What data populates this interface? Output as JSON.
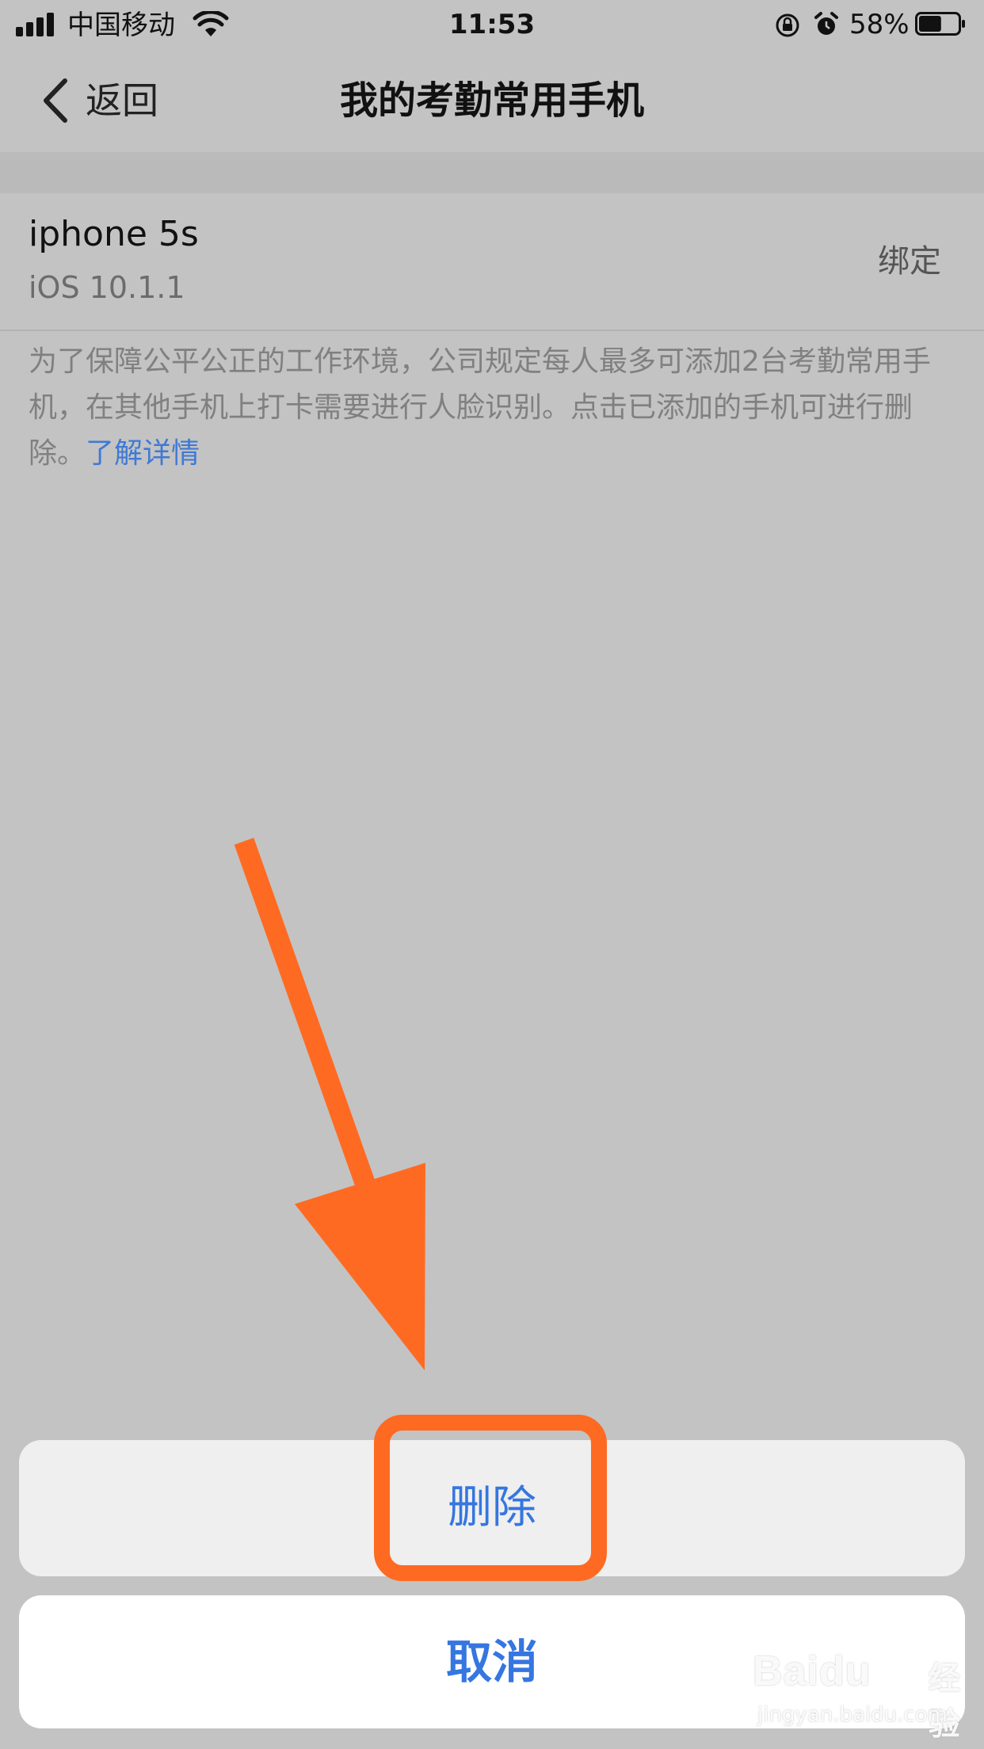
{
  "status_bar": {
    "carrier": "中国移动",
    "time": "11:53",
    "battery_percent": "58%",
    "battery_level": 0.58,
    "icons": [
      "signal-icon",
      "wifi-icon",
      "orientation-lock-icon",
      "alarm-icon",
      "battery-icon"
    ]
  },
  "nav": {
    "back_label": "返回",
    "title": "我的考勤常用手机"
  },
  "device": {
    "name": "iphone 5s",
    "os": "iOS 10.1.1",
    "action_label": "绑定"
  },
  "notice": {
    "text": "为了保障公平公正的工作环境，公司规定每人最多可添加2台考勤常用手机，在其他手机上打卡需要进行人脸识别。点击已添加的手机可进行删除。",
    "link": "了解详情"
  },
  "action_sheet": {
    "delete_label": "删除",
    "cancel_label": "取消"
  },
  "watermark": {
    "logo": "Baidu",
    "sub": "经验",
    "url": "jingyan.baidu.com"
  },
  "colors": {
    "accent_blue": "#3576e0",
    "annotation_orange": "#ff6a22",
    "dim_background": "#c3c3c3"
  }
}
